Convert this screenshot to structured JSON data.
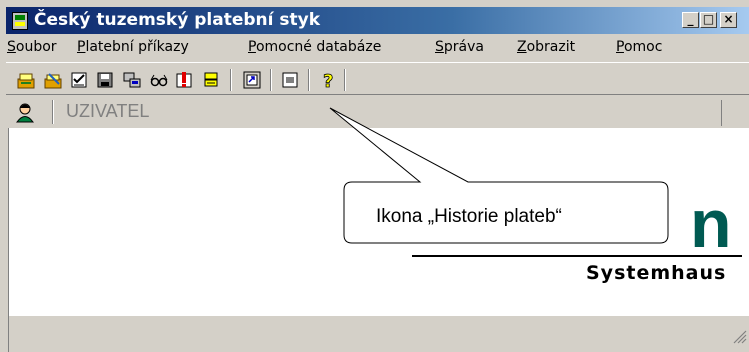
{
  "window": {
    "title": "Český tuzemský platební styk"
  },
  "title_buttons": {
    "minimize": "_",
    "maximize": "□",
    "close": "×"
  },
  "menu": [
    {
      "label": "Soubor",
      "accel": "S",
      "rest": "oubor"
    },
    {
      "label": "Platební příkazy",
      "accel": "P",
      "rest": "latební příkazy"
    },
    {
      "label": "Pomocné databáze",
      "accel": "P",
      "rest": "omocné databáze"
    },
    {
      "label": "Správa",
      "accel": "S",
      "rest": "práva"
    },
    {
      "label": "Zobrazit",
      "accel": "Z",
      "rest": "obrazit"
    },
    {
      "label": "Pomoc",
      "accel": "P",
      "rest": "omoc"
    }
  ],
  "toolbar": {
    "icons": [
      "new-order-icon",
      "edit-order-icon",
      "checklist-icon",
      "save-icon",
      "import-icon",
      "glasses-icon",
      "warning-icon",
      "payment-history-icon",
      "export-icon",
      "window-icon",
      "help-icon"
    ]
  },
  "user": {
    "label": "UZIVATEL"
  },
  "logo": {
    "main": "unitron",
    "accent_letter": "n",
    "subtitle": "Systemhaus",
    "accent_color": "#005a52"
  },
  "callout": {
    "text": "Ikona „Historie plateb“"
  }
}
